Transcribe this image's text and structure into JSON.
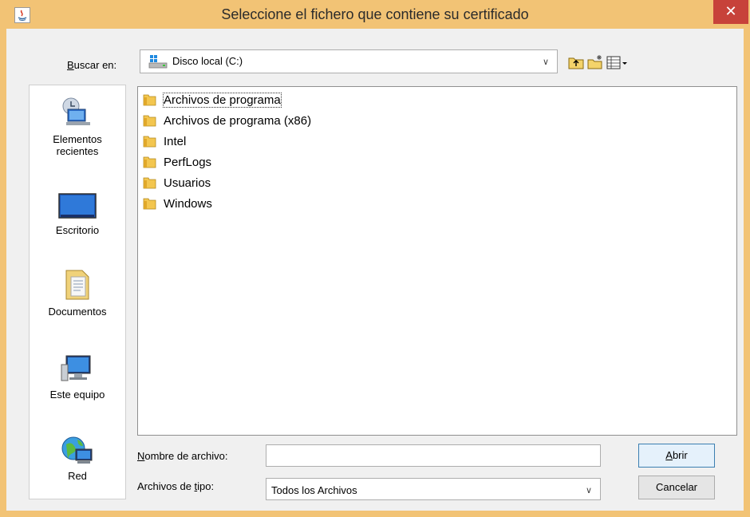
{
  "window": {
    "title": "Seleccione el fichero que contiene su certificado",
    "close_glyph": "✕",
    "colors": {
      "frame": "#f2c375",
      "close": "#c7423a",
      "client": "#f0f0f0"
    }
  },
  "toolbar": {
    "look_in_label_pre": "",
    "look_in_label_underlined": "B",
    "look_in_label_post": "uscar en:",
    "look_in_value": "Disco local (C:)",
    "up_icon": "up-folder-icon",
    "new_folder_icon": "new-folder-icon",
    "view_menu_icon": "view-details-icon"
  },
  "places": [
    {
      "label_line1": "Elementos",
      "label_line2": "recientes",
      "icon": "recent-items-icon"
    },
    {
      "label_line1": "Escritorio",
      "label_line2": "",
      "icon": "desktop-icon"
    },
    {
      "label_line1": "Documentos",
      "label_line2": "",
      "icon": "documents-icon"
    },
    {
      "label_line1": "Este equipo",
      "label_line2": "",
      "icon": "this-pc-icon"
    },
    {
      "label_line1": "Red",
      "label_line2": "",
      "icon": "network-icon"
    }
  ],
  "files": [
    {
      "name": "Archivos de programa",
      "selected": true
    },
    {
      "name": "Archivos de programa (x86)",
      "selected": false
    },
    {
      "name": "Intel",
      "selected": false
    },
    {
      "name": "PerfLogs",
      "selected": false
    },
    {
      "name": "Usuarios",
      "selected": false
    },
    {
      "name": "Windows",
      "selected": false
    }
  ],
  "form": {
    "filename_label_underlined": "N",
    "filename_label_post": "ombre de archivo:",
    "filename_value": "",
    "filetype_label_pre": "Archivos de ",
    "filetype_label_underlined": "t",
    "filetype_label_post": "ipo:",
    "filetype_value": "Todos los Archivos"
  },
  "buttons": {
    "open_underlined": "A",
    "open_post": "brir",
    "cancel": "Cancelar"
  }
}
